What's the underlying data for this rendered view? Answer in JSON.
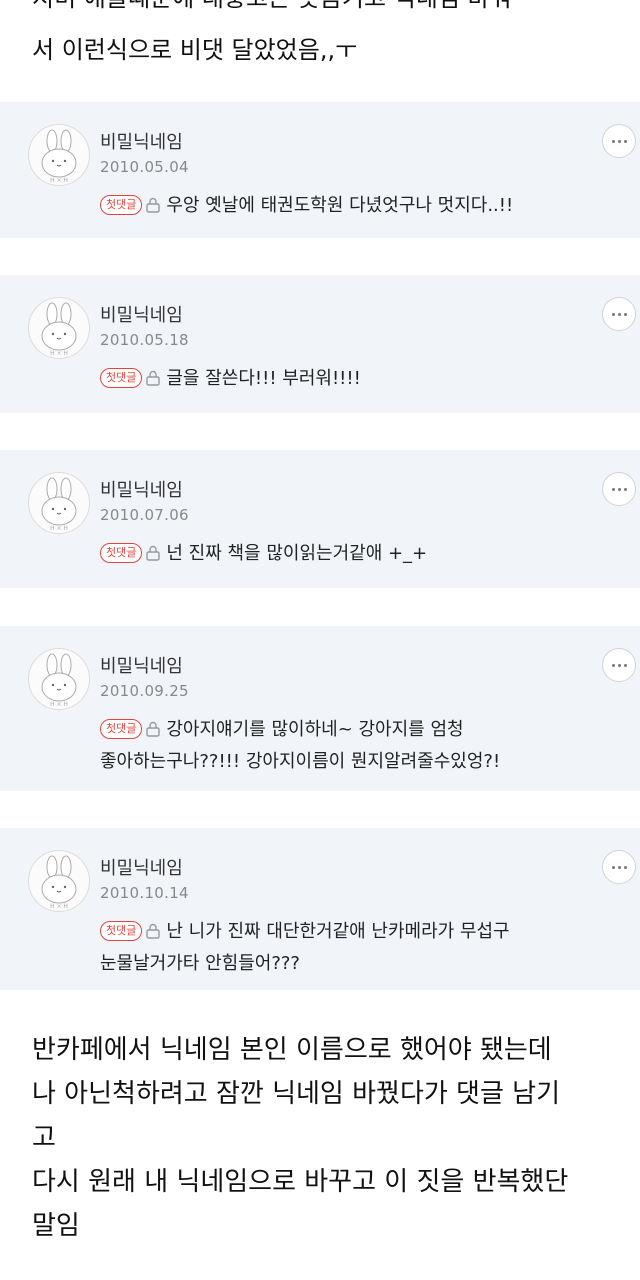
{
  "intro": {
    "line1": "지미 애들때문에 대충고는 숫돔기고 닉네임 바꿔",
    "line2": "서 이런식으로 비댓 달았었음,,ㅜ"
  },
  "comments": [
    {
      "nickname": "비밀닉네임",
      "date": "2010.05.04",
      "badge": "첫댓글",
      "lines": [
        "우앙 옛날에 태권도학원 다녔엇구나 멋지다..!!"
      ]
    },
    {
      "nickname": "비밀닉네임",
      "date": "2010.05.18",
      "badge": "첫댓글",
      "lines": [
        "글을 잘쓴다!!! 부러워!!!!"
      ]
    },
    {
      "nickname": "비밀닉네임",
      "date": "2010.07.06",
      "badge": "첫댓글",
      "lines": [
        "넌 진짜 책을 많이읽는거같애 +_+"
      ]
    },
    {
      "nickname": "비밀닉네임",
      "date": "2010.09.25",
      "badge": "첫댓글",
      "lines": [
        "강아지얘기를 많이하네~ 강아지를 엄청",
        "좋아하는구나??!!! 강아지이름이 뭔지알려줄수있엉?!"
      ]
    },
    {
      "nickname": "비밀닉네임",
      "date": "2010.10.14",
      "badge": "첫댓글",
      "lines": [
        "난 니가 진짜 대단한거같애 난카메라가 무섭구",
        "눈물날거가타 안힘들어???"
      ]
    }
  ],
  "outro": {
    "lines": [
      "반카페에서 닉네임 본인 이름으로 했어야 됐는데",
      "나 아닌척하려고 잠깐 닉네임 바꿨다가 댓글 남기",
      "고",
      "다시 원래 내 닉네임으로 바꾸고 이 짓을 반복했단",
      "말임"
    ]
  },
  "icons": {
    "avatar": "bunny-avatar-icon",
    "more": "more-options-icon",
    "lock": "lock-icon"
  },
  "colors": {
    "card_bg": "#f1f5fa",
    "badge": "#e0453d"
  }
}
